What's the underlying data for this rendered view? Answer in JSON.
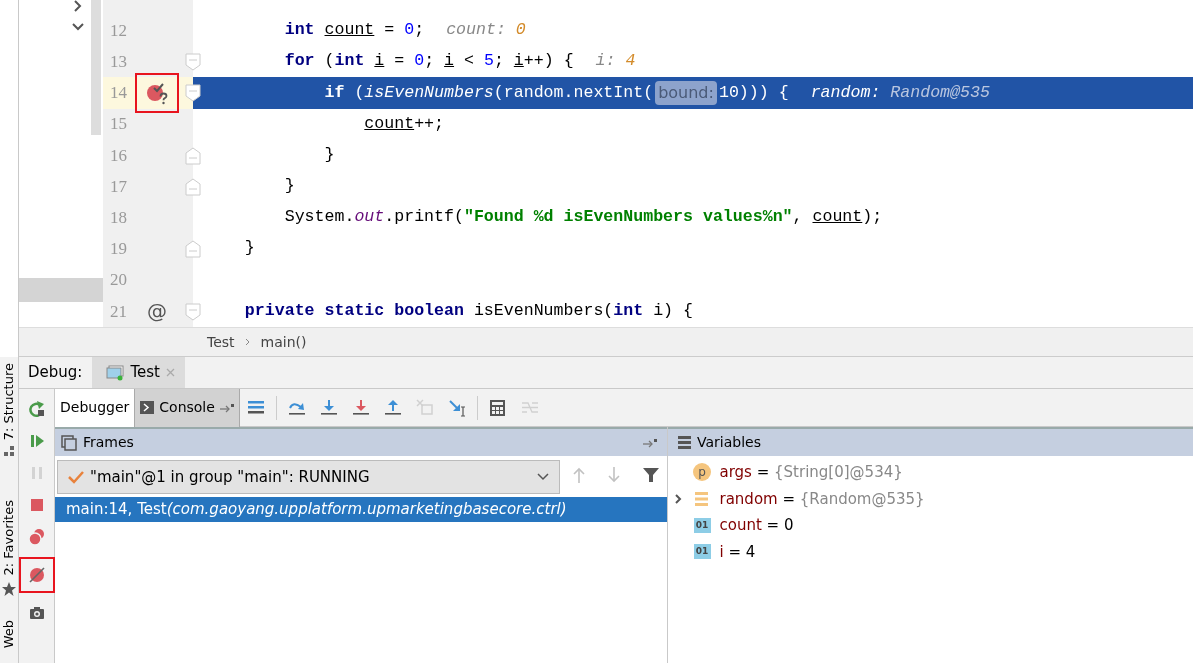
{
  "project_tree": {
    "chevrons": [
      {
        "expanded": false
      },
      {
        "expanded": true
      }
    ]
  },
  "editor": {
    "lines": [
      {
        "number": "12",
        "current": false,
        "breakpoint": false,
        "outlined": false,
        "segments": [
          {
            "kind": "code",
            "tokens": [
              {
                "kind": "keyword",
                "t": "        int "
              },
              {
                "kind": "variable",
                "t": "count"
              },
              {
                "kind": "plain",
                "t": " = "
              },
              {
                "kind": "number",
                "t": "0"
              },
              {
                "kind": "plain",
                "t": ";"
              }
            ]
          },
          {
            "kind": "hint",
            "name": "count:",
            "value": "0"
          }
        ]
      },
      {
        "number": "13",
        "current": false,
        "breakpoint": false,
        "outlined": false,
        "fold": {
          "kind": "start"
        },
        "segments": [
          {
            "kind": "code",
            "tokens": [
              {
                "kind": "keyword",
                "t": "        for"
              },
              {
                "kind": "plain",
                "t": " ("
              },
              {
                "kind": "keyword",
                "t": "int "
              },
              {
                "kind": "variable",
                "t": "i"
              },
              {
                "kind": "plain",
                "t": " = "
              },
              {
                "kind": "number",
                "t": "0"
              },
              {
                "kind": "plain",
                "t": "; "
              },
              {
                "kind": "variable",
                "t": "i"
              },
              {
                "kind": "plain",
                "t": " < "
              },
              {
                "kind": "number",
                "t": "5"
              },
              {
                "kind": "plain",
                "t": "; "
              },
              {
                "kind": "variable",
                "t": "i"
              },
              {
                "kind": "plain",
                "t": "++) {"
              }
            ]
          },
          {
            "kind": "hint",
            "name": "i:",
            "value": "4"
          }
        ]
      },
      {
        "number": "14",
        "current": true,
        "breakpoint": true,
        "outlined": true,
        "fold": {
          "kind": "start"
        },
        "segments": [
          {
            "kind": "code",
            "tokens": [
              {
                "kind": "keyword",
                "t": "            if"
              },
              {
                "kind": "plain",
                "t": " ("
              },
              {
                "kind": "method",
                "t": "isEvenNumbers"
              },
              {
                "kind": "plain",
                "t": "(random.nextInt("
              }
            ]
          },
          {
            "kind": "param",
            "text": "bound:"
          },
          {
            "kind": "code",
            "tokens": [
              {
                "kind": "plain",
                "t": "10))) {"
              }
            ]
          },
          {
            "kind": "hint",
            "name": "random:",
            "value": "Random@535"
          }
        ]
      },
      {
        "number": "15",
        "current": false,
        "breakpoint": false,
        "outlined": false,
        "segments": [
          {
            "kind": "code",
            "tokens": [
              {
                "kind": "variable",
                "t": "                count"
              },
              {
                "kind": "plain",
                "t": "++;"
              }
            ]
          }
        ]
      },
      {
        "number": "16",
        "current": false,
        "breakpoint": false,
        "outlined": false,
        "fold": {
          "kind": "end"
        },
        "segments": [
          {
            "kind": "code",
            "tokens": [
              {
                "kind": "plain",
                "t": "            }"
              }
            ]
          }
        ]
      },
      {
        "number": "17",
        "current": false,
        "breakpoint": false,
        "outlined": false,
        "fold": {
          "kind": "end"
        },
        "segments": [
          {
            "kind": "code",
            "tokens": [
              {
                "kind": "plain",
                "t": "        }"
              }
            ]
          }
        ]
      },
      {
        "number": "18",
        "current": false,
        "breakpoint": false,
        "outlined": false,
        "segments": [
          {
            "kind": "code",
            "tokens": [
              {
                "kind": "plain",
                "t": "        System."
              },
              {
                "kind": "static_field",
                "t": "out"
              },
              {
                "kind": "plain",
                "t": ".printf("
              },
              {
                "kind": "string",
                "t": "\"Found %d isEvenNumbers values%n\""
              },
              {
                "kind": "plain",
                "t": ", "
              },
              {
                "kind": "variable",
                "t": "count"
              },
              {
                "kind": "plain",
                "t": ");"
              }
            ]
          }
        ]
      },
      {
        "number": "19",
        "current": false,
        "breakpoint": false,
        "outlined": false,
        "fold": {
          "kind": "end"
        },
        "segments": [
          {
            "kind": "code",
            "tokens": [
              {
                "kind": "plain",
                "t": "    }"
              }
            ]
          }
        ]
      },
      {
        "number": "20",
        "current": false,
        "breakpoint": false,
        "outlined": false
      },
      {
        "number": "21",
        "current": false,
        "breakpoint": false,
        "outlined": false,
        "mark": "@",
        "fold": {
          "kind": "start"
        },
        "segments": [
          {
            "kind": "code",
            "tokens": [
              {
                "kind": "keyword",
                "t": "    private static boolean"
              },
              {
                "kind": "plain",
                "t": " isEvenNumbers("
              },
              {
                "kind": "keyword",
                "t": "int"
              },
              {
                "kind": "plain",
                "t": " i) {"
              }
            ]
          }
        ]
      }
    ]
  },
  "breadcrumbs": [
    "Test",
    "main()"
  ],
  "debug": {
    "label": "Debug:",
    "tabs": [
      {
        "label": "Test",
        "selected": true
      }
    ]
  },
  "side_stripe": [
    {
      "label": "7: Structure"
    },
    {
      "label": "2: Favorites"
    },
    {
      "label": "Web"
    }
  ],
  "debug_actions": [
    {
      "kind": "rerun",
      "disabled": false,
      "outlined": false
    },
    {
      "kind": "resume",
      "disabled": false,
      "outlined": false
    },
    {
      "kind": "pause",
      "disabled": true,
      "outlined": false
    },
    {
      "kind": "stop",
      "disabled": false,
      "outlined": false
    },
    {
      "kind": "breakpoints",
      "disabled": false,
      "outlined": false
    },
    {
      "kind": "mute",
      "disabled": false,
      "outlined": true
    },
    {
      "kind": "snapshot",
      "disabled": false,
      "outlined": false
    }
  ],
  "subtabs": [
    {
      "label": "Debugger",
      "selected": true
    },
    {
      "label": "Console",
      "selected": false
    }
  ],
  "toolbar": [
    {
      "kind": "menu",
      "disabled": false
    },
    {
      "kind": "step_over",
      "disabled": false
    },
    {
      "kind": "step_into",
      "disabled": false
    },
    {
      "kind": "force_step_into",
      "disabled": false
    },
    {
      "kind": "step_out",
      "disabled": false
    },
    {
      "kind": "drop_frame",
      "disabled": true
    },
    {
      "kind": "run_to_cursor",
      "disabled": false
    },
    {
      "kind": "evaluate",
      "disabled": false
    },
    {
      "kind": "trace",
      "disabled": true
    }
  ],
  "frames": {
    "title": "Frames",
    "thread": "\"main\"@1 in group \"main\": RUNNING",
    "nav": [
      {
        "kind": "up",
        "disabled": true
      },
      {
        "kind": "down",
        "disabled": true
      },
      {
        "kind": "filter",
        "disabled": false
      }
    ],
    "items": [
      {
        "location": "main:14, Test",
        "package": "(com.gaoyang.upplatform.upmarketingbasecore.ctrl)",
        "selected": true
      }
    ]
  },
  "variables": {
    "title": "Variables",
    "items": [
      {
        "kind": "parameter",
        "badge": "p",
        "name": "args",
        "sign": "=",
        "value": "{String[0]@534}",
        "expandable": false
      },
      {
        "kind": "field",
        "name": "random",
        "sign": "=",
        "value": "{Random@535}",
        "expandable": true
      },
      {
        "kind": "primitive",
        "badge": "01",
        "name": "count",
        "sign": "=",
        "value": "0",
        "expandable": false
      },
      {
        "kind": "primitive",
        "badge": "01",
        "name": "i",
        "sign": "=",
        "value": "4",
        "expandable": false
      }
    ]
  }
}
